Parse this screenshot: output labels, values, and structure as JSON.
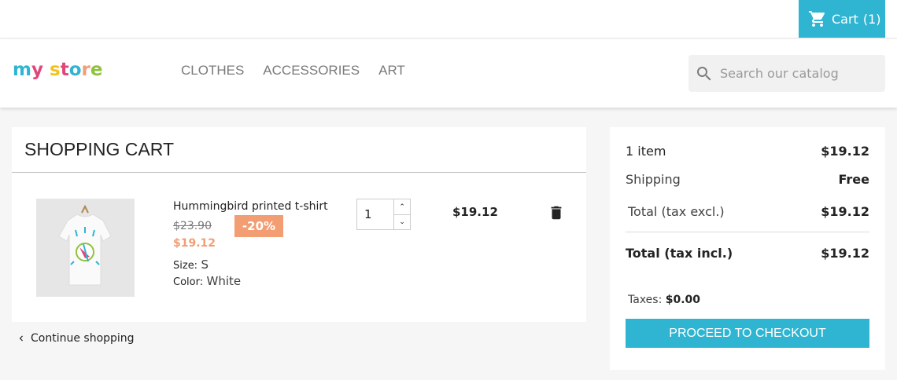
{
  "topbar": {
    "cart_label": "Cart",
    "cart_count": "(1)"
  },
  "header": {
    "logo": {
      "parts": [
        "m",
        "y",
        " ",
        "s",
        "t",
        "o",
        "r",
        "e"
      ]
    },
    "nav": [
      "CLOTHES",
      "ACCESSORIES",
      "ART"
    ],
    "search_placeholder": "Search our catalog"
  },
  "cart": {
    "title": "SHOPPING CART",
    "item": {
      "name": "Hummingbird printed t-shirt",
      "old_price": "$23.90",
      "discount": "-20%",
      "price": "$19.12",
      "size_label": "Size:",
      "size_value": "S",
      "color_label": "Color:",
      "color_value": "White",
      "quantity": "1",
      "line_total": "$19.12"
    },
    "continue_label": "Continue shopping"
  },
  "summary": {
    "items_label": "1 item",
    "items_value": "$19.12",
    "shipping_label": "Shipping",
    "shipping_value": "Free",
    "total_excl_label": "Total (tax excl.)",
    "total_excl_value": "$19.12",
    "total_incl_label": "Total (tax incl.)",
    "total_incl_value": "$19.12",
    "taxes_label": "Taxes:",
    "taxes_value": "$0.00",
    "checkout_label": "PROCEED TO CHECKOUT"
  },
  "colors": {
    "accent": "#2fb5d2",
    "discount": "#f39d72",
    "logo": [
      "#2fb5d2",
      "#e0467b",
      "#ffffff",
      "#f3c21a",
      "#e0467b",
      "#2fb5d2",
      "#f39d72",
      "#8fc23b"
    ]
  },
  "icons": [
    "cart-icon",
    "search-icon",
    "trash-icon",
    "chevron-left-icon",
    "chevron-up-icon",
    "chevron-down-icon"
  ]
}
